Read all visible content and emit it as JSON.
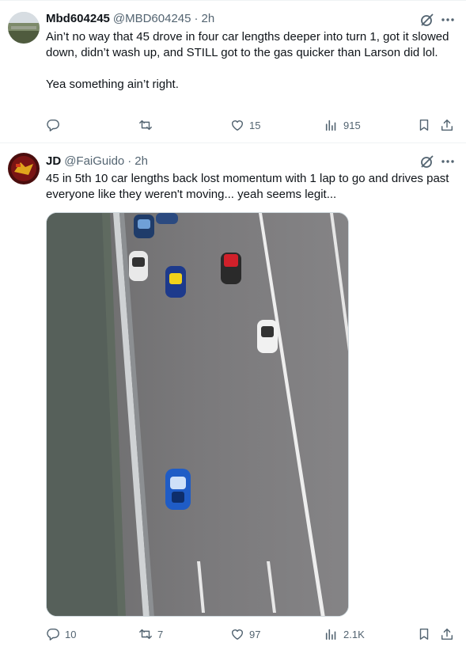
{
  "tweets": [
    {
      "display_name": "Mbd604245",
      "handle": "@MBD604245",
      "separator": "·",
      "time": "2h",
      "text": "Ain’t no way that 45 drove in four car lengths deeper into turn 1, got it slowed down, didn’t wash up, and STILL got to the gas quicker than Larson did lol.\n\nYea something ain’t right.",
      "actions": {
        "reply_count": "",
        "retweet_count": "",
        "like_count": "15",
        "view_count": "915"
      }
    },
    {
      "display_name": "JD",
      "handle": "@FaiGuido",
      "separator": "·",
      "time": "2h",
      "text": "45 in 5th 10 car lengths back lost momentum with 1 lap to go and drives past everyone like they weren't moving... yeah seems legit...",
      "has_media": true,
      "actions": {
        "reply_count": "10",
        "retweet_count": "7",
        "like_count": "97",
        "view_count": "2.1K"
      }
    }
  ],
  "icons": {
    "reply": "reply-icon",
    "retweet": "retweet-icon",
    "like": "heart-icon",
    "views": "views-icon",
    "bookmark": "bookmark-icon",
    "share": "share-icon",
    "grok": "grok-icon",
    "more": "more-icon"
  },
  "colors": {
    "text": "#0f1419",
    "secondary": "#536471",
    "divider": "#eff3f4"
  }
}
